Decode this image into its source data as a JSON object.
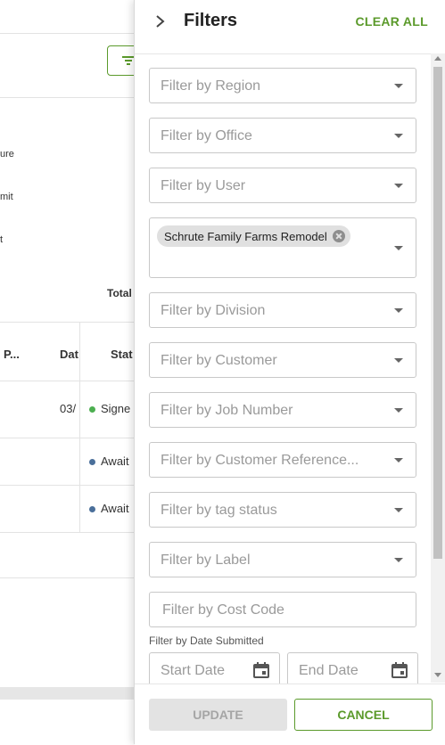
{
  "background": {
    "text_ure": "ure",
    "text_mit": "mit",
    "text_t": "t",
    "total_label": "Total",
    "col_p": "P...",
    "col_dat": "Dat",
    "col_stat": "Stat",
    "row1_date": "03/",
    "row1_status": "Signe",
    "row2_status": "Await",
    "row3_status": "Await",
    "colors": {
      "signed": "#4caf50",
      "awaiting": "#4a6f9a"
    }
  },
  "panel": {
    "title": "Filters",
    "clear_all": "CLEAR ALL",
    "filters": {
      "region": "Filter by Region",
      "office": "Filter by Office",
      "user": "Filter by User",
      "project_chip": "Schrute Family Farms Remodel",
      "division": "Filter by Division",
      "customer": "Filter by Customer",
      "job_number": "Filter by Job Number",
      "customer_reference": "Filter by Customer Reference...",
      "tag_status": "Filter by tag status",
      "label": "Filter by Label",
      "cost_code": "Filter by Cost Code"
    },
    "date_label": "Filter by Date Submitted",
    "start_date": "Start Date",
    "end_date": "End Date",
    "update": "UPDATE",
    "cancel": "CANCEL",
    "accent": "#5b9a2b"
  }
}
